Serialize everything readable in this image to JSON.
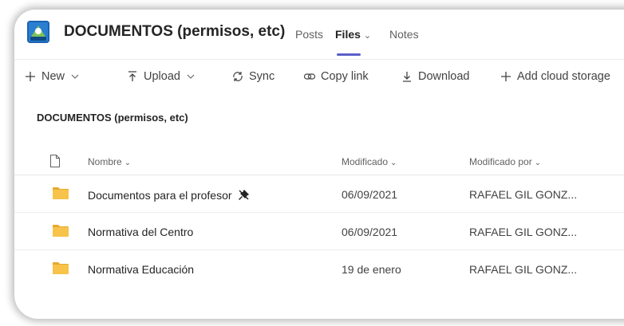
{
  "header": {
    "channel_title": "DOCUMENTOS (permisos, etc)",
    "tabs": [
      {
        "label": "Posts"
      },
      {
        "label": "Files"
      },
      {
        "label": "Notes"
      }
    ],
    "active_tab": "Files",
    "accent_color": "#5b5fc7"
  },
  "toolbar": {
    "new_label": "New",
    "upload_label": "Upload",
    "sync_label": "Sync",
    "copy_link_label": "Copy link",
    "download_label": "Download",
    "add_cloud_label": "Add cloud storage"
  },
  "breadcrumb": "DOCUMENTOS (permisos, etc)",
  "table": {
    "columns": {
      "name": "Nombre",
      "modified": "Modificado",
      "modified_by": "Modificado por"
    },
    "rows": [
      {
        "name": "Documentos para el profesor",
        "modified": "06/09/2021",
        "modified_by": "RAFAEL GIL GONZ...",
        "icon": "folder-icon",
        "pinned_icon": "pin-off-icon"
      },
      {
        "name": "Normativa del Centro",
        "modified": "06/09/2021",
        "modified_by": "RAFAEL GIL GONZ...",
        "icon": "folder-icon"
      },
      {
        "name": "Normativa Educación",
        "modified": "19 de enero",
        "modified_by": "RAFAEL GIL GONZ...",
        "icon": "folder-icon"
      }
    ]
  },
  "colors": {
    "folder": "#f8c34a",
    "folder_dark": "#e6a92d"
  }
}
